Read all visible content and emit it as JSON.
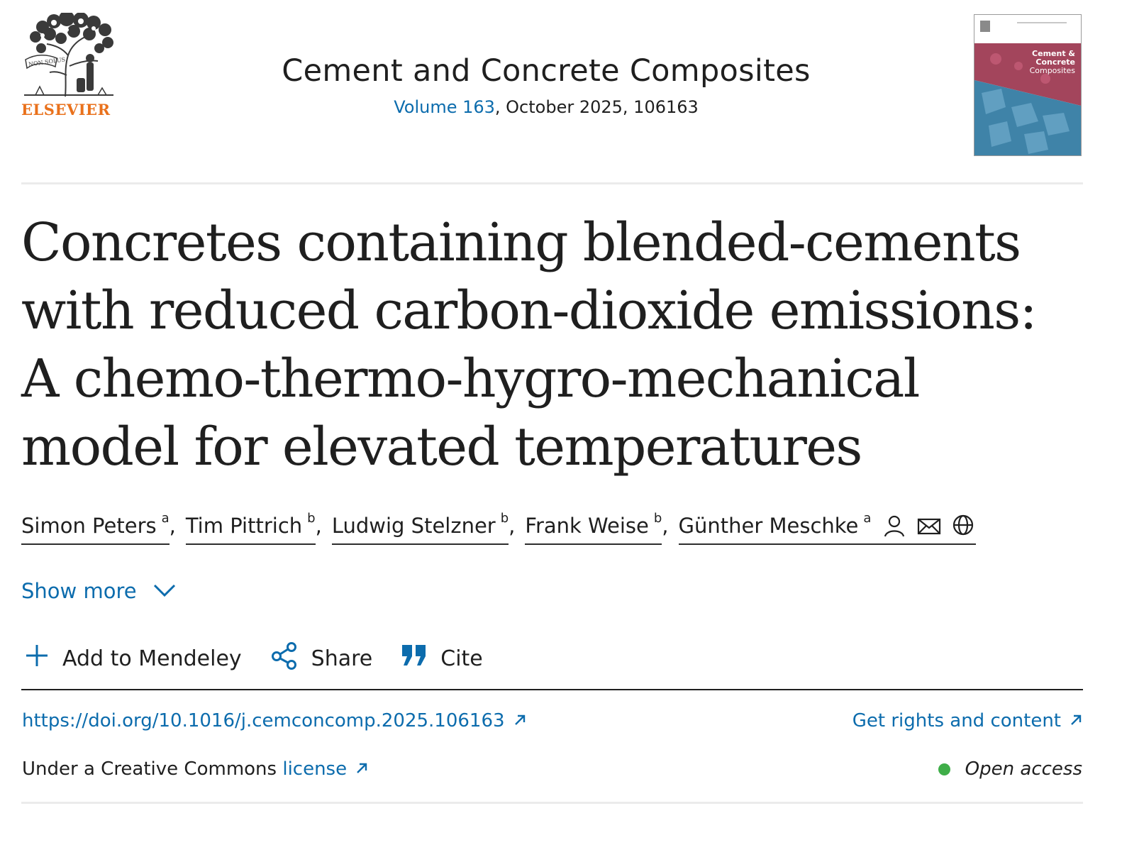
{
  "header": {
    "publisher_name": "ELSEVIER",
    "publisher_motto": "NON SOLUS",
    "journal_title": "Cement and Concrete Composites",
    "volume_link": "Volume 163",
    "issue_rest": ", October 2025, 106163",
    "cover_title_lines": [
      "Cement &",
      "Concrete",
      "Composites"
    ]
  },
  "article": {
    "title": "Concretes containing blended-cements with reduced carbon-dioxide emissions: A chemo-thermo-hygro-mechanical model for elevated temperatures"
  },
  "authors": [
    {
      "name": "Simon Peters",
      "affil": "a"
    },
    {
      "name": "Tim Pittrich",
      "affil": "b"
    },
    {
      "name": "Ludwig Stelzner",
      "affil": "b"
    },
    {
      "name": "Frank Weise",
      "affil": "b"
    },
    {
      "name": "Günther Meschke",
      "affil": "a"
    }
  ],
  "author_icons": [
    "person-icon",
    "mail-icon",
    "globe-icon"
  ],
  "show_more": "Show more",
  "actions": {
    "mendeley": "Add to Mendeley",
    "share": "Share",
    "cite": "Cite"
  },
  "links": {
    "doi": "https://doi.org/10.1016/j.cemconcomp.2025.106163",
    "rights": "Get rights and content"
  },
  "license": {
    "prefix": "Under a Creative Commons ",
    "link": "license"
  },
  "open_access": "Open access",
  "colors": {
    "link": "#0c6cad",
    "publisher": "#e9711c",
    "open_access_dot": "#3fae49",
    "text": "#1f1f1f"
  }
}
